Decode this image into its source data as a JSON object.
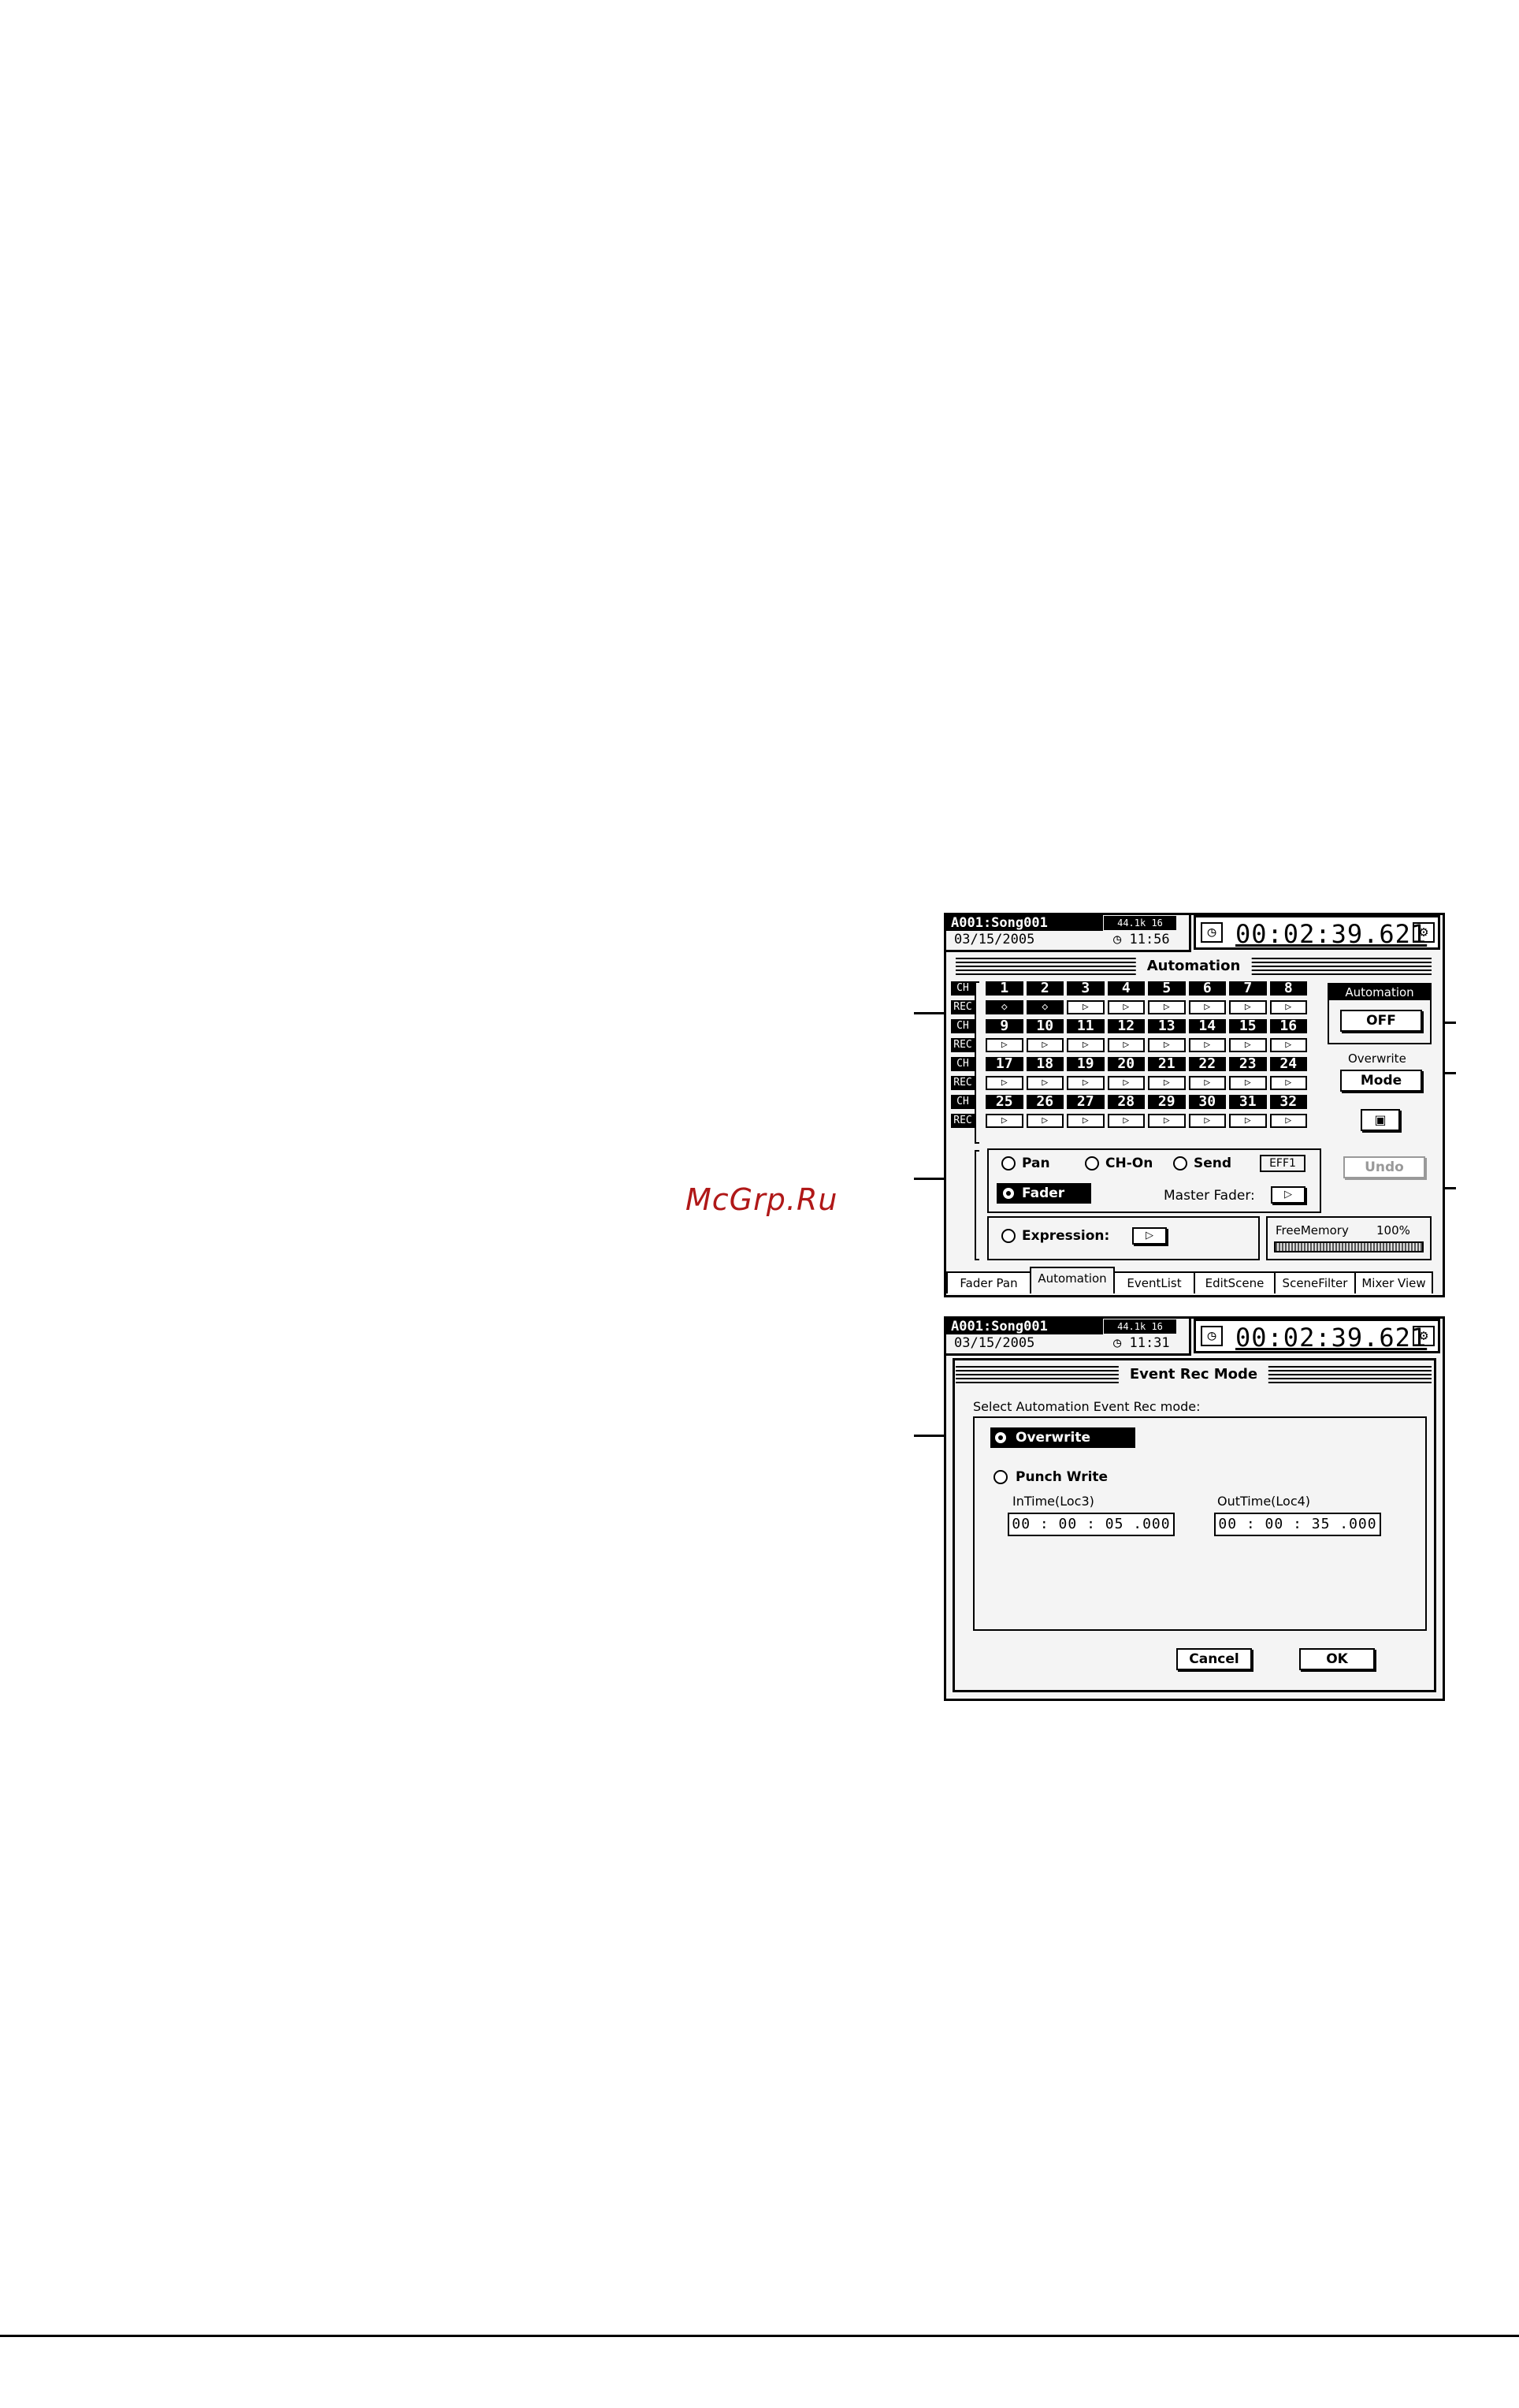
{
  "watermark": "McGrp.Ru",
  "screen1": {
    "song": "A001:Song001",
    "sample_rate": "44.1k 16",
    "date": "03/15/2005",
    "clock": "◷ 11:56",
    "counter_icon": "clock-icon",
    "time": "00:02:39.621",
    "gear_icon": "gear-icon",
    "title": "Automation",
    "row_labels": [
      "CH",
      "REC",
      "CH",
      "REC",
      "CH",
      "REC",
      "CH",
      "REC"
    ],
    "channels": [
      "1",
      "2",
      "3",
      "4",
      "5",
      "6",
      "7",
      "8",
      "9",
      "10",
      "11",
      "12",
      "13",
      "14",
      "15",
      "16",
      "17",
      "18",
      "19",
      "20",
      "21",
      "22",
      "23",
      "24",
      "25",
      "26",
      "27",
      "28",
      "29",
      "30",
      "31",
      "32"
    ],
    "rec_symbol_on": "◇",
    "rec_symbol_off": "▷",
    "automation_label": "Automation",
    "automation_value": "OFF",
    "overwrite_label": "Overwrite",
    "mode_button": "Mode",
    "snapshot_icon": "camera-icon",
    "undo_button": "Undo",
    "pan_label": "Pan",
    "chon_label": "CH-On",
    "send_label": "Send",
    "send_value": "EFF1",
    "fader_label": "Fader",
    "master_fader_label": "Master Fader:",
    "expression_label": "Expression:",
    "free_memory_label": "FreeMemory",
    "free_memory_value": "100%",
    "tabs": [
      "Fader Pan",
      "Automation",
      "EventList",
      "EditScene",
      "SceneFilter",
      "Mixer View"
    ],
    "active_tab": 1
  },
  "screen2": {
    "song": "A001:Song001",
    "sample_rate": "44.1k 16",
    "date": "03/15/2005",
    "clock": "◷ 11:31",
    "time": "00:02:39.621",
    "title": "Event Rec Mode",
    "prompt": "Select Automation Event Rec mode:",
    "overwrite_label": "Overwrite",
    "punch_write_label": "Punch Write",
    "in_time_label": "InTime(Loc3)",
    "in_time_value": "00 : 00 : 05 .000",
    "out_time_label": "OutTime(Loc4)",
    "out_time_value": "00 : 00 : 35 .000",
    "cancel_button": "Cancel",
    "ok_button": "OK"
  }
}
